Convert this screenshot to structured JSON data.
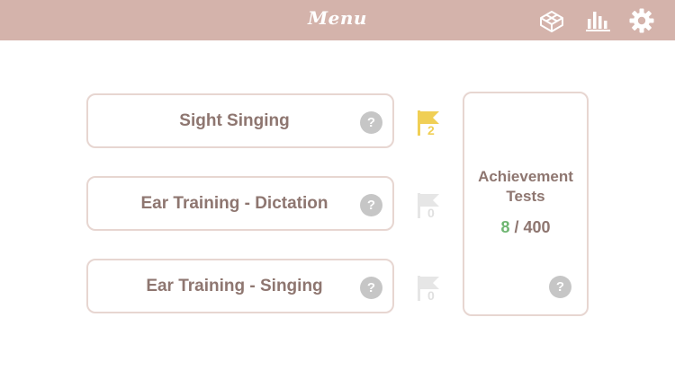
{
  "header": {
    "title": "Menu",
    "icons": [
      "store-icon",
      "stats-icon",
      "settings-icon"
    ]
  },
  "menu": [
    {
      "label": "Sight Singing",
      "flags": "2",
      "flag_color": "#f0cf55"
    },
    {
      "label": "Ear Training - Dictation",
      "flags": "0",
      "flag_color": "#e6e6e6"
    },
    {
      "label": "Ear Training - Singing",
      "flags": "0",
      "flag_color": "#e6e6e6"
    }
  ],
  "help_symbol": "?",
  "achievement": {
    "title_line1": "Achievement",
    "title_line2": "Tests",
    "completed": "8",
    "separator": " / ",
    "total": "400"
  },
  "colors": {
    "header": "#d4b3ab",
    "text": "#8e7670",
    "border": "#e7d6d1",
    "help": "#c6c6c6",
    "accent_green": "#6fb672",
    "flag_gold": "#f0cf55"
  }
}
